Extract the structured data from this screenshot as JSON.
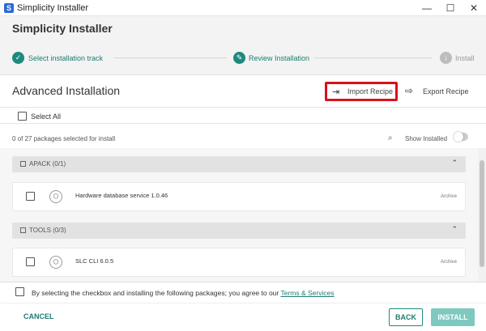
{
  "window": {
    "title": "Simplicity Installer",
    "icon": "simplicity-app-icon",
    "minimize": "—",
    "maximize": "☐",
    "close": "✕"
  },
  "header": {
    "title": "Simplicity Installer"
  },
  "stepper": {
    "steps": [
      {
        "label": "Select installation track",
        "state": "done",
        "icon": "✓"
      },
      {
        "label": "Review Installation",
        "state": "current",
        "icon": "✎"
      },
      {
        "label": "Install",
        "state": "pending",
        "icon": "↓"
      }
    ]
  },
  "advanced": {
    "title": "Advanced Installation",
    "import_label": "Import Recipe",
    "import_icon": "⇥",
    "export_label": "Export Recipe",
    "export_icon": "⇨"
  },
  "select_all": {
    "label": "Select All"
  },
  "summary": {
    "count_text": "0 of 27 packages selected for install",
    "show_installed_label": "Show Installed",
    "search_icon": "⌕"
  },
  "groups": [
    {
      "label": "APACK (0/1)",
      "chevron": "⌃",
      "packages": [
        {
          "name": "Hardware database service 1.0.46",
          "type": "Archive",
          "icon": "⬡"
        }
      ]
    },
    {
      "label": "TOOLS (0/3)",
      "chevron": "⌃",
      "packages": [
        {
          "name": "SLC CLI 6.0.5",
          "type": "Archive",
          "icon": "⬡"
        }
      ]
    }
  ],
  "terms": {
    "text": "By selecting the checkbox and installing the following packages; you agree to our ",
    "link": "Terms & Services"
  },
  "footer": {
    "cancel": "CANCEL",
    "back": "BACK",
    "install": "INSTALL"
  },
  "colors": {
    "accent": "#1d8a7e",
    "highlight_border": "#d6131a",
    "install_disabled": "#7fc8c0"
  }
}
